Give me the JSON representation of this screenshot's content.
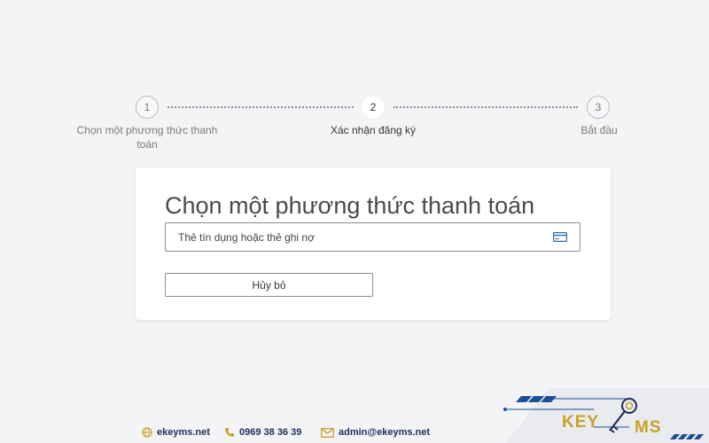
{
  "stepper": {
    "steps": [
      {
        "number": "1",
        "label_line1": "Chọn một phương thức thanh",
        "label_line2": "toán"
      },
      {
        "number": "2",
        "label_line1": "Xác nhận đăng ký"
      },
      {
        "number": "3",
        "label_line1": "Bắt đầu"
      }
    ],
    "active_step": 2
  },
  "card": {
    "title": "Chọn một phương thức thanh toán",
    "payment_option": "Thẻ tín dụng hoặc thẻ ghi nợ",
    "cancel_label": "Hủy bỏ"
  },
  "footer": {
    "website": "ekeyms.net",
    "phone": "0969 38 36 39",
    "email": "admin@ekeyms.net",
    "logo_text_left": "KEY",
    "logo_text_right": "MS"
  },
  "colors": {
    "background": "#f3f4f6",
    "footer_text": "#1f2d5a",
    "logo_gold": "#c9a227",
    "logo_navy": "#1f2d5a",
    "card_icon": "#2f6da3"
  },
  "icons": [
    "card-icon",
    "globe-icon",
    "phone-icon",
    "mail-icon",
    "key-icon"
  ]
}
